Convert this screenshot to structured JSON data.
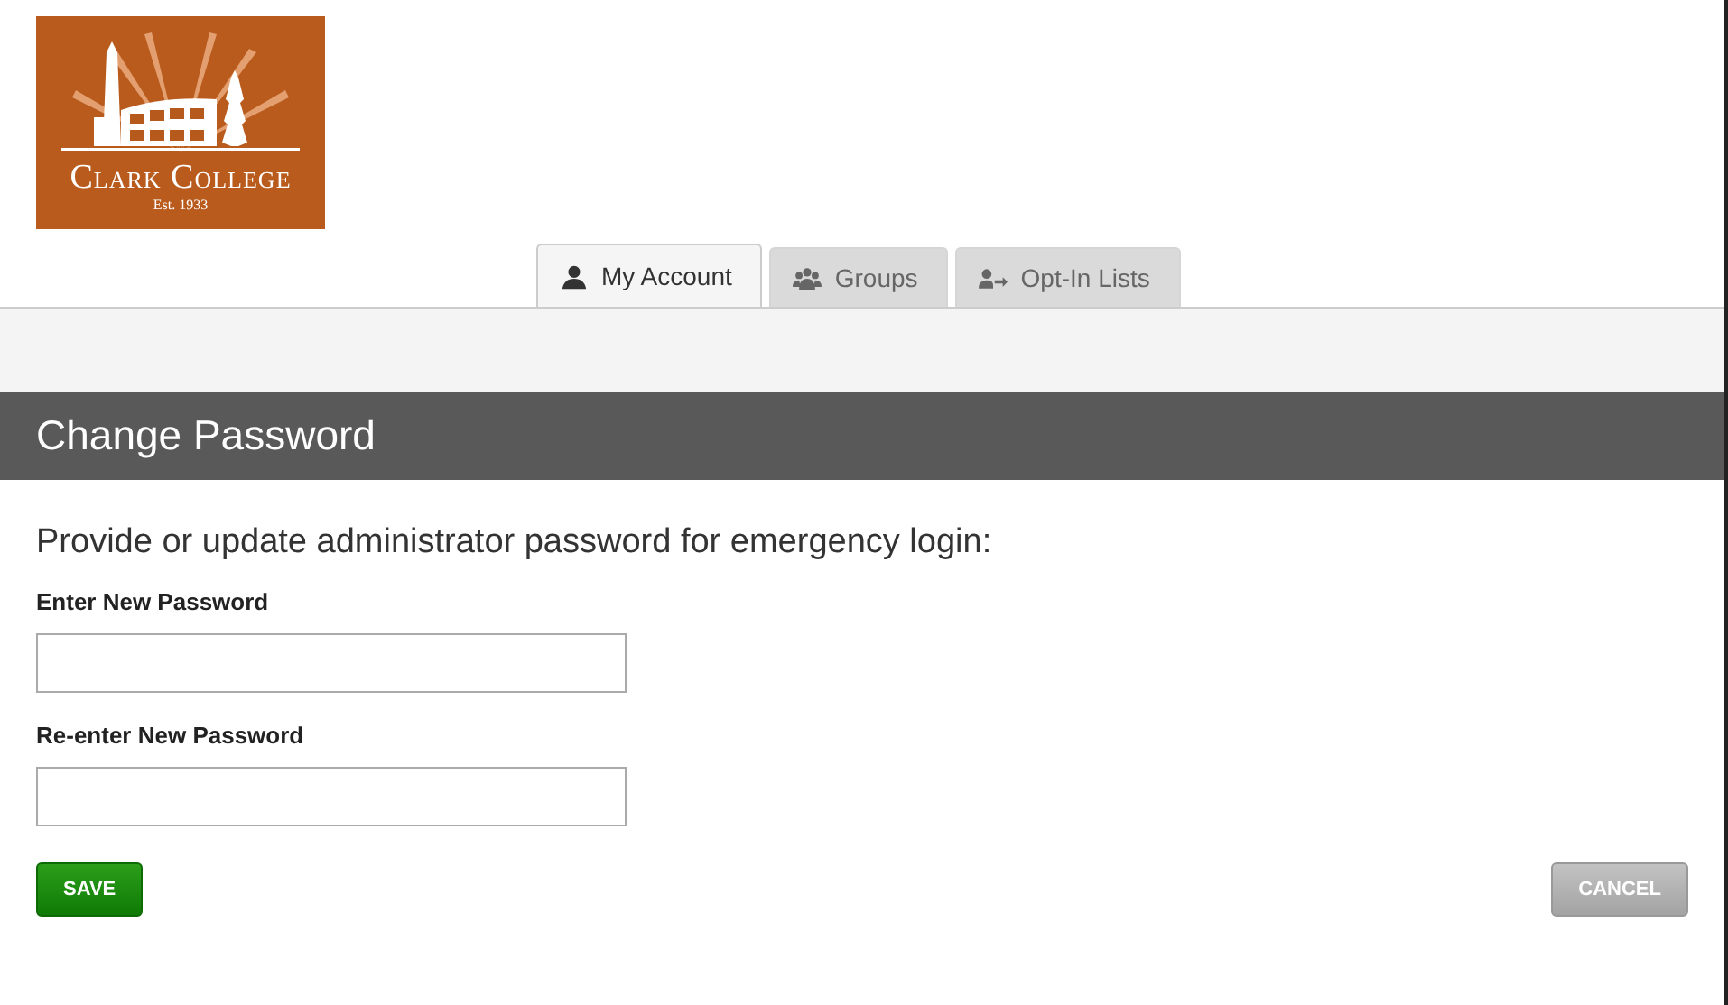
{
  "logo": {
    "name": "Clark College",
    "established": "Est. 1933"
  },
  "tabs": [
    {
      "kind": "account",
      "label": "My Account",
      "selected": true
    },
    {
      "kind": "groups",
      "label": "Groups",
      "selected": false
    },
    {
      "kind": "optin",
      "label": "Opt-In Lists",
      "selected": false
    }
  ],
  "section": {
    "title": "Change Password"
  },
  "form": {
    "intro": "Provide or update administrator password for emergency login:",
    "fields": [
      {
        "label": "Enter New Password"
      },
      {
        "label": "Re-enter New Password"
      }
    ]
  },
  "buttons": [
    {
      "kind": "primary",
      "label": "SAVE"
    },
    {
      "kind": "secondary",
      "label": "CANCEL"
    }
  ]
}
